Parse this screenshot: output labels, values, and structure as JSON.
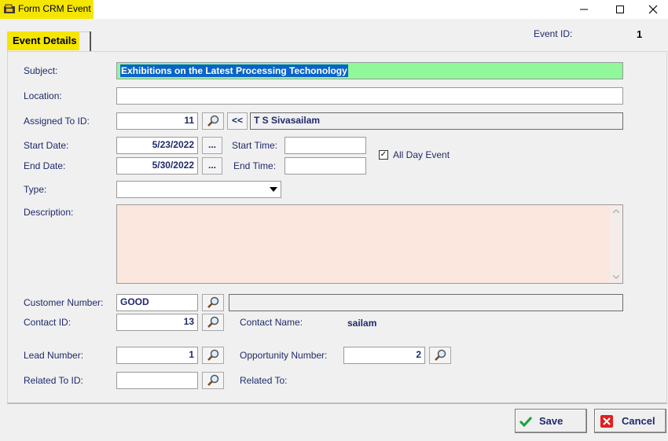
{
  "window": {
    "title": "Form CRM Event",
    "minimize": "—",
    "maximize": "☐",
    "close": "✕"
  },
  "tab": {
    "label": "Event Details"
  },
  "event_id": {
    "label": "Event ID:",
    "value": "1"
  },
  "subject": {
    "label": "Subject:",
    "value": "Exhibitions on the Latest Processing Techonology"
  },
  "location": {
    "label": "Location:",
    "value": ""
  },
  "assigned": {
    "label": "Assigned To ID:",
    "id": "11",
    "back_label": "<<",
    "name": "T S Sivasailam"
  },
  "start_date": {
    "label": "Start Date:",
    "value": "5/23/2022",
    "dots": "..."
  },
  "end_date": {
    "label": "End Date:",
    "value": "5/30/2022",
    "dots": "..."
  },
  "start_time": {
    "label": "Start Time:",
    "value": ""
  },
  "end_time": {
    "label": "End Time:",
    "value": ""
  },
  "all_day": {
    "label": "All Day Event",
    "checked": true,
    "mark": "✓"
  },
  "type": {
    "label": "Type:",
    "value": ""
  },
  "description": {
    "label": "Description:",
    "value": ""
  },
  "customer": {
    "label": "Customer Number:",
    "value": "GOOD",
    "name": ""
  },
  "contact": {
    "label": "Contact ID:",
    "value": "13",
    "name_label": "Contact Name:",
    "name_value": "sailam"
  },
  "lead": {
    "label": "Lead Number:",
    "value": "1"
  },
  "opportunity": {
    "label": "Opportunity Number:",
    "value": "2"
  },
  "related": {
    "label": "Related To ID:",
    "value": "",
    "to_label": "Related To:"
  },
  "buttons": {
    "save": "Save",
    "cancel": "Cancel"
  },
  "colors": {
    "title_highlight": "#f5e600",
    "subject_bg": "#90f79a",
    "selection": "#0a64c8",
    "description_bg": "#fbe7dd",
    "label_text": "#1f2a6b"
  }
}
